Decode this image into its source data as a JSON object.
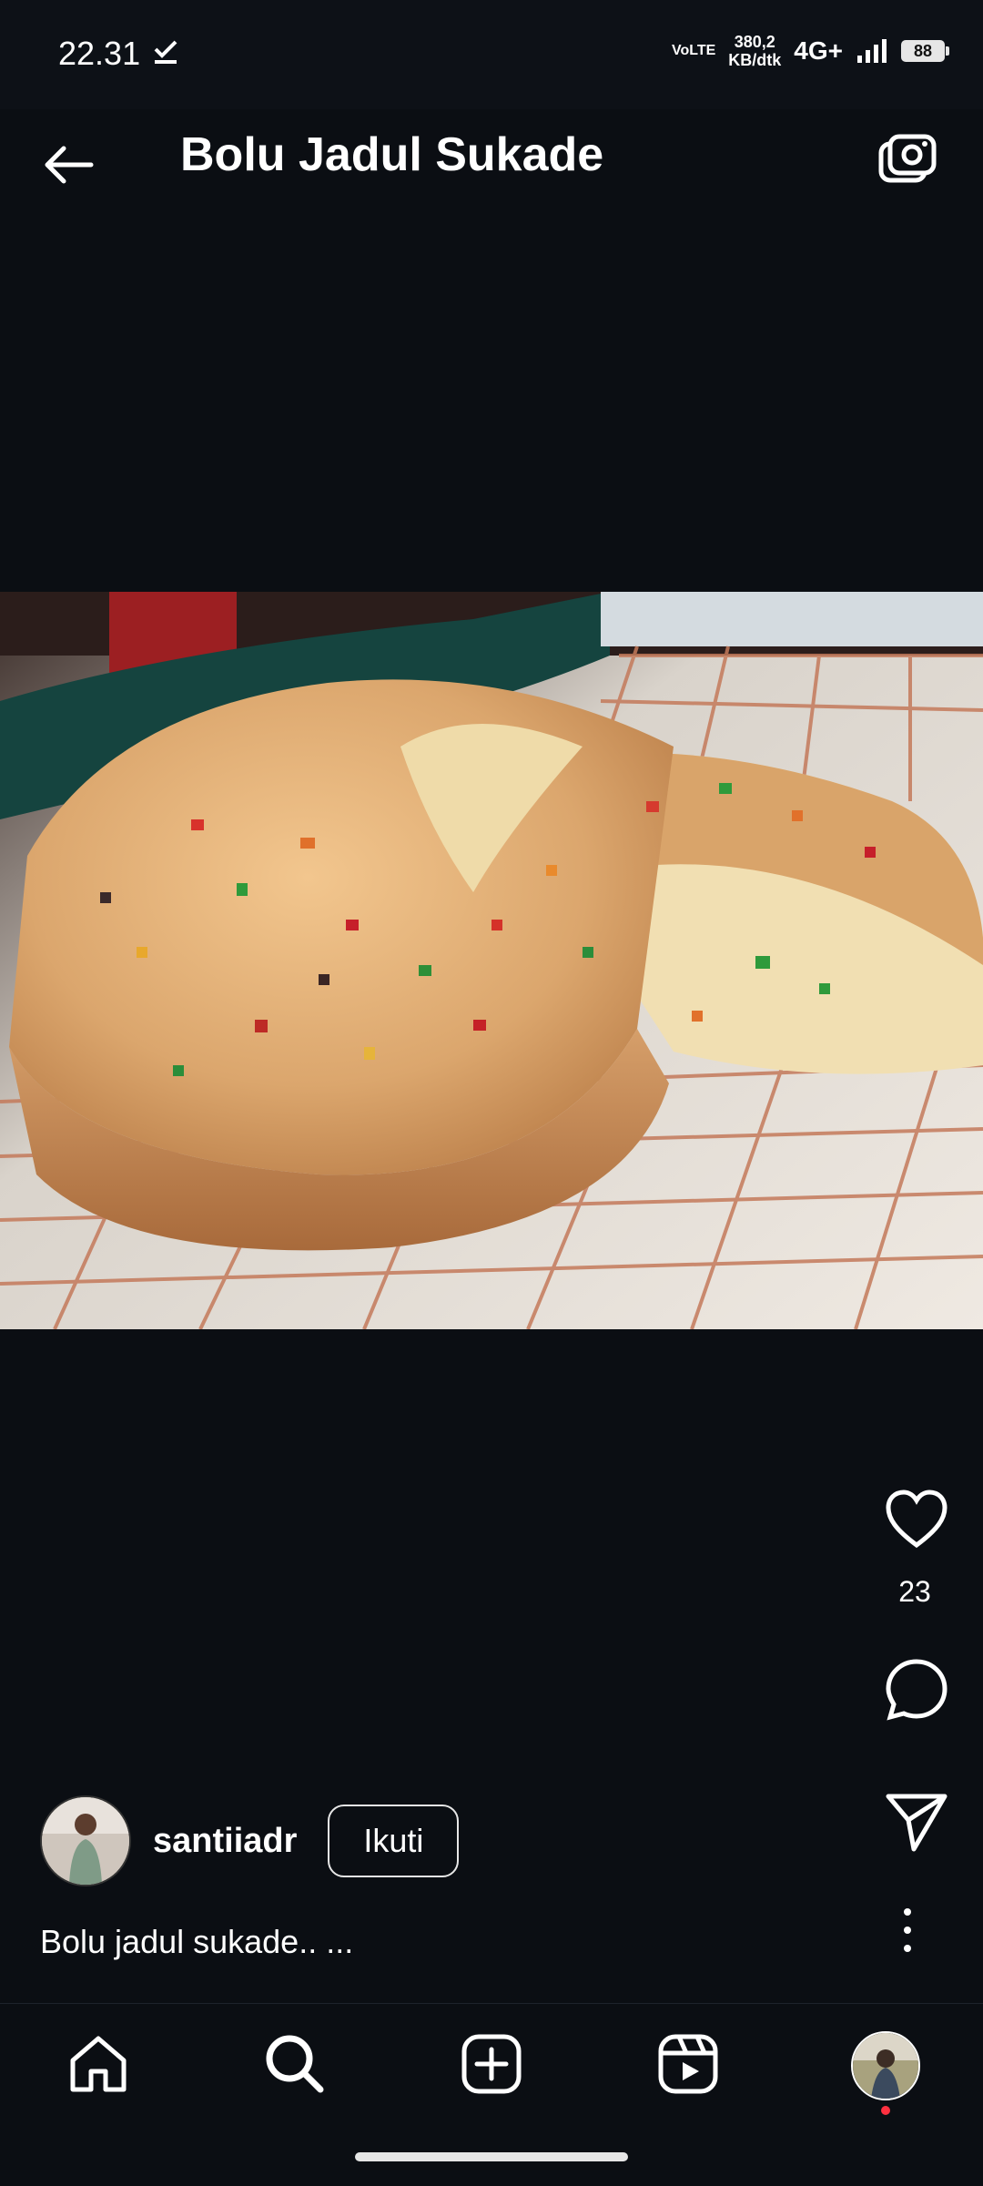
{
  "status_bar": {
    "time": "22.31",
    "network_top": "VoLTE",
    "speed_value": "380,2",
    "speed_unit": "KB/dtk",
    "network_type": "4G+",
    "battery": "88"
  },
  "header": {
    "title": "Bolu Jadul Sukade"
  },
  "post": {
    "like_count": "23",
    "username": "santiiadr",
    "follow_label": "Ikuti",
    "caption": "Bolu jadul sukade.. ..."
  },
  "icons": {
    "back": "arrow-left-icon",
    "camera": "camera-icon",
    "like": "heart-icon",
    "comment": "comment-icon",
    "share": "send-icon",
    "more": "more-vertical-icon",
    "home": "home-icon",
    "search": "search-icon",
    "create": "plus-square-icon",
    "reels": "reels-icon"
  },
  "colors": {
    "background": "#0b0e13",
    "text": "#ffffff",
    "notification_dot": "#ff3040"
  }
}
